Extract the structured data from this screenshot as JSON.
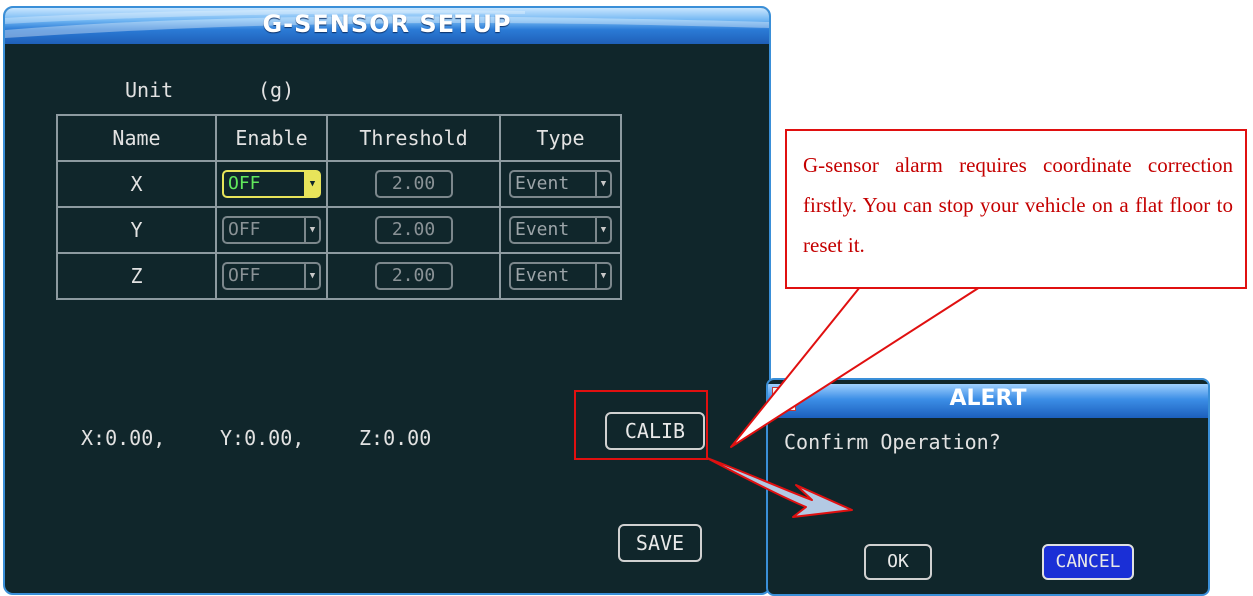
{
  "window": {
    "title": "G-SENSOR SETUP"
  },
  "unit": {
    "label": "Unit",
    "value": "(g)"
  },
  "table": {
    "headers": [
      "Name",
      "Enable",
      "Threshold",
      "Type"
    ],
    "rows": [
      {
        "name": "X",
        "enable": "OFF",
        "threshold": "2.00",
        "type": "Event"
      },
      {
        "name": "Y",
        "enable": "OFF",
        "threshold": "2.00",
        "type": "Event"
      },
      {
        "name": "Z",
        "enable": "OFF",
        "threshold": "2.00",
        "type": "Event"
      }
    ]
  },
  "readout": {
    "x": "X:0.00,",
    "y": "Y:0.00,",
    "z": "Z:0.00"
  },
  "buttons": {
    "calib": "CALIB",
    "save": "SAVE"
  },
  "alert": {
    "title": "ALERT",
    "message": "Confirm Operation?",
    "ok": "OK",
    "cancel": "CANCEL"
  },
  "callout": {
    "text": "G-sensor alarm requires coordinate correction firstly. You can stop your vehicle on a flat floor to reset it."
  },
  "colors": {
    "panel": "#10262b",
    "accent_border": "#3a8fd8",
    "active_highlight": "#e8e45a",
    "active_value": "#61e85c",
    "annotation_red": "#e01010",
    "cancel_blue": "#1a2fd6"
  },
  "icons": {
    "dropdown": "chevron-down-icon",
    "alert": "alert-icon"
  }
}
